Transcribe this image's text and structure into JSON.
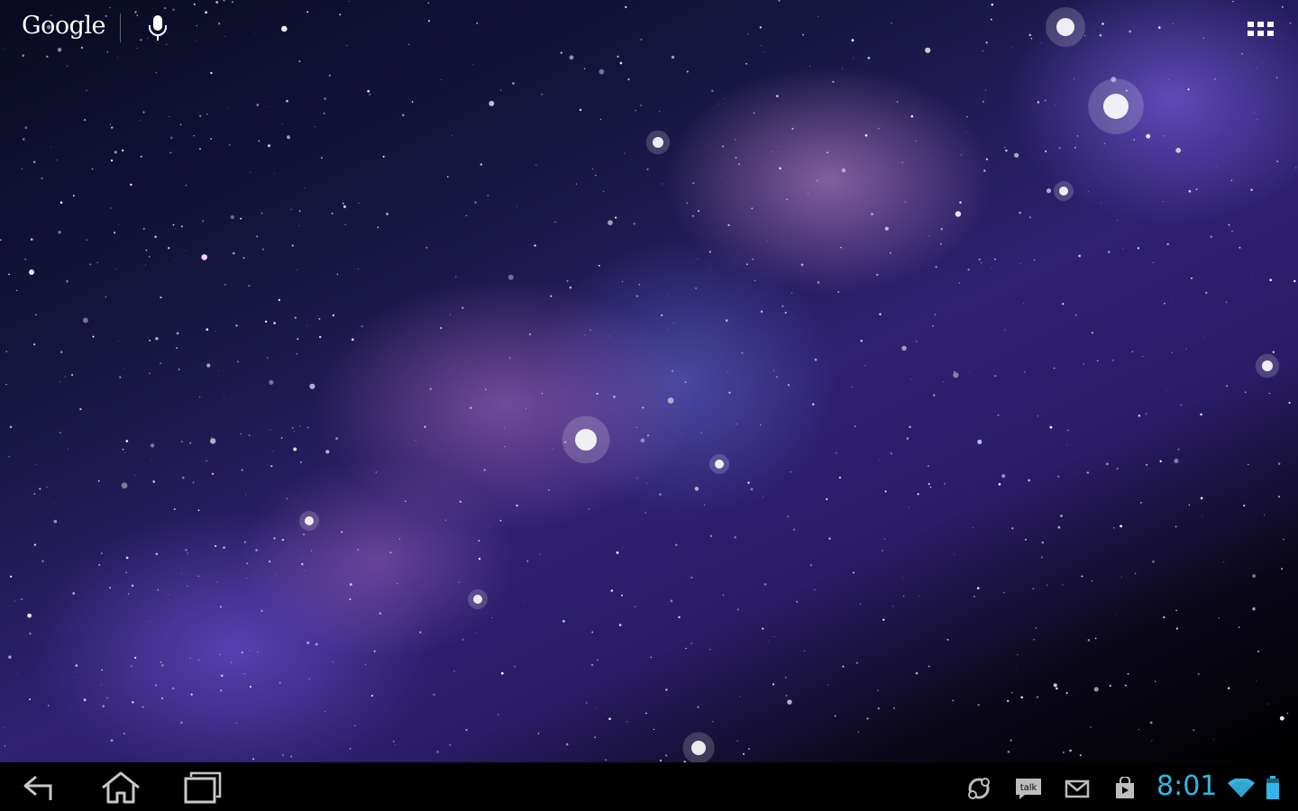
{
  "search_bar": {
    "logo_text": "Google",
    "mic_icon": "microphone-icon"
  },
  "apps_button": {
    "icon": "all-apps-grid-icon"
  },
  "navigation": {
    "back_icon": "back-arrow-icon",
    "home_icon": "home-icon",
    "recents_icon": "recent-apps-icon"
  },
  "notifications": [
    {
      "icon": "sync-icon"
    },
    {
      "icon": "talk-icon",
      "label": "talk"
    },
    {
      "icon": "gmail-icon"
    },
    {
      "icon": "market-icon"
    }
  ],
  "status": {
    "time": "8:01",
    "wifi_icon": "wifi-icon",
    "battery_icon": "battery-icon",
    "accent_color": "#33b5e5"
  }
}
